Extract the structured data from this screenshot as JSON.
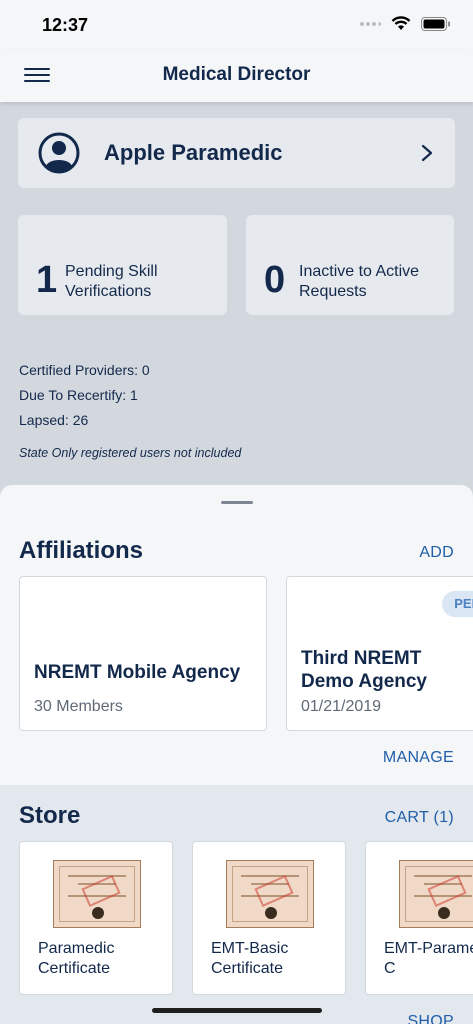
{
  "status_bar": {
    "time": "12:37"
  },
  "header": {
    "title": "Medical Director"
  },
  "profile": {
    "name": "Apple Paramedic"
  },
  "stats": [
    {
      "count": "1",
      "label": "Pending Skill Verifications"
    },
    {
      "count": "0",
      "label": "Inactive to Active Requests"
    }
  ],
  "info": {
    "certified": "Certified Providers: 0",
    "due": "Due To Recertify: 1",
    "lapsed": "Lapsed: 26",
    "note": "State Only registered users not included"
  },
  "affiliations": {
    "title": "Affiliations",
    "add_label": "ADD",
    "manage_label": "MANAGE",
    "items": [
      {
        "name": "NREMT Mobile Agency",
        "sub": "30 Members"
      },
      {
        "name": "Third NREMT Demo Agency",
        "sub": "01/21/2019",
        "badge": "PEN"
      }
    ]
  },
  "store": {
    "title": "Store",
    "cart_label": "CART (1)",
    "shop_label": "SHOP",
    "items": [
      {
        "name": "Paramedic Certificate"
      },
      {
        "name": "EMT-Basic Certificate"
      },
      {
        "name": "EMT-Paramedic C"
      }
    ]
  },
  "colors": {
    "navy": "#13294b",
    "link": "#1f5ea8",
    "card": "#e6e9ee"
  }
}
